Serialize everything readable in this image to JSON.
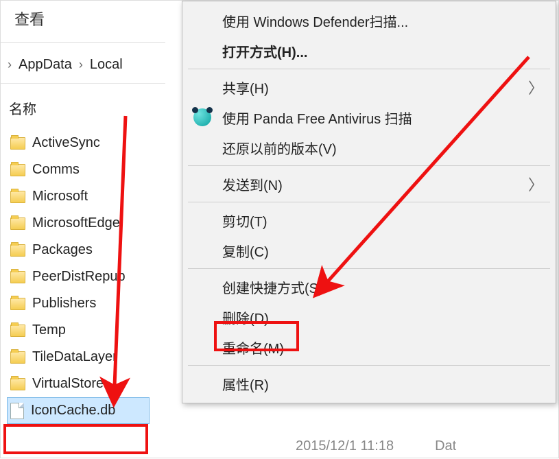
{
  "toolbar": {
    "view_tab": "查看"
  },
  "breadcrumbs": {
    "seg1": "AppData",
    "seg2": "Local"
  },
  "columns": {
    "name": "名称"
  },
  "files": [
    {
      "label": "ActiveSync",
      "type": "folder"
    },
    {
      "label": "Comms",
      "type": "folder"
    },
    {
      "label": "Microsoft",
      "type": "folder"
    },
    {
      "label": "MicrosoftEdge",
      "type": "folder"
    },
    {
      "label": "Packages",
      "type": "folder"
    },
    {
      "label": "PeerDistRepub",
      "type": "folder"
    },
    {
      "label": "Publishers",
      "type": "folder"
    },
    {
      "label": "Temp",
      "type": "folder"
    },
    {
      "label": "TileDataLayer",
      "type": "folder"
    },
    {
      "label": "VirtualStore",
      "type": "folder"
    },
    {
      "label": "IconCache.db",
      "type": "file",
      "selected": true
    }
  ],
  "context_menu": {
    "scan_defender": "使用 Windows Defender扫描...",
    "open_with": "打开方式(H)...",
    "share": "共享(H)",
    "panda_scan": "使用 Panda Free Antivirus 扫描",
    "restore_prev": "还原以前的版本(V)",
    "send_to": "发送到(N)",
    "cut": "剪切(T)",
    "copy": "复制(C)",
    "create_shortcut": "创建快捷方式(S)",
    "delete": "删除(D)",
    "rename": "重命名(M)",
    "properties": "属性(R)"
  },
  "status": {
    "date": "2015/12/1 11:18",
    "col_date": "Dat"
  },
  "annotation": {
    "highlight_color": "#e11"
  }
}
